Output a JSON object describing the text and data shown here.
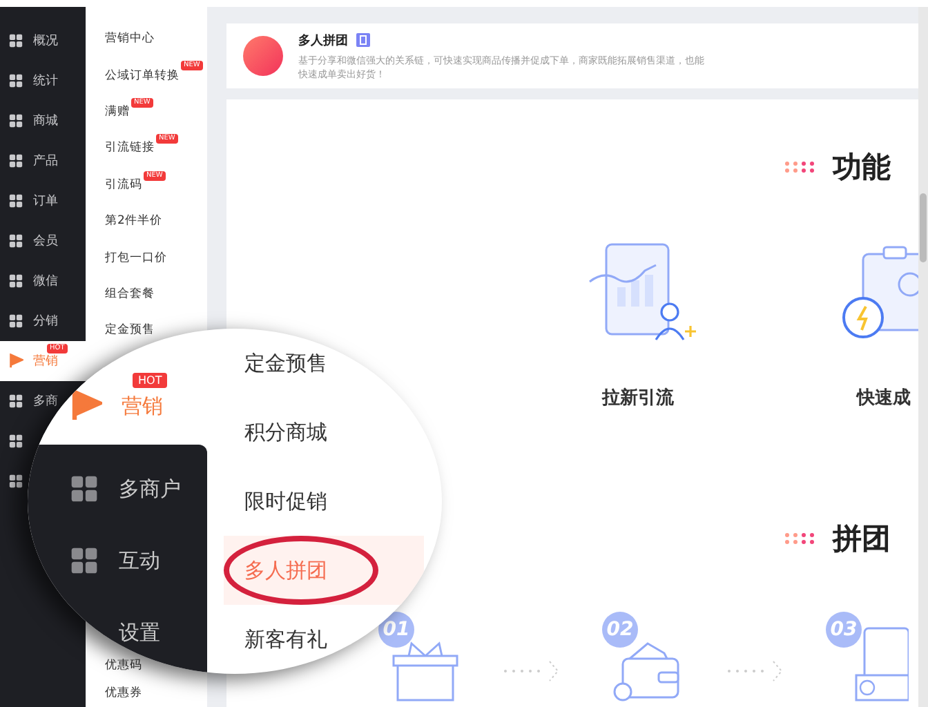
{
  "sidebar": {
    "items": [
      {
        "label": "概况",
        "selected": false
      },
      {
        "label": "统计",
        "selected": false
      },
      {
        "label": "商城",
        "selected": false
      },
      {
        "label": "产品",
        "selected": false
      },
      {
        "label": "订单",
        "selected": false
      },
      {
        "label": "会员",
        "selected": false
      },
      {
        "label": "微信",
        "selected": false
      },
      {
        "label": "分销",
        "selected": false
      },
      {
        "label": "营销",
        "selected": true,
        "badge": "HOT"
      },
      {
        "label": "多商",
        "selected": false
      },
      {
        "selected": false
      },
      {
        "selected": false
      }
    ]
  },
  "submenu": {
    "items": [
      {
        "label": "营销中心"
      },
      {
        "label": "公域订单转换",
        "badge": "NEW"
      },
      {
        "label": "满赠",
        "badge": "NEW"
      },
      {
        "label": "引流链接",
        "badge": "NEW"
      },
      {
        "label": "引流码",
        "badge": "NEW"
      },
      {
        "label": "第2件半价"
      },
      {
        "label": "打包一口价"
      },
      {
        "label": "组合套餐"
      },
      {
        "label": "定金预售"
      }
    ],
    "bottom_items": [
      {
        "label": "优惠码"
      },
      {
        "label": "优惠券"
      }
    ]
  },
  "header": {
    "title": "多人拼团",
    "description": "基于分享和微信强大的关系链，可快速实现商品传播并促成下单，商家既能拓展销售渠道，也能快速成单卖出好货！"
  },
  "sections": [
    {
      "title": "功能",
      "features": [
        {
          "label": "拉新引流"
        },
        {
          "label": "快速成"
        }
      ]
    },
    {
      "title": "拼团",
      "steps": [
        {
          "number": "01"
        },
        {
          "number": "02"
        },
        {
          "number": "03"
        }
      ]
    }
  ],
  "magnifier": {
    "nav": [
      {
        "label": "营销",
        "selected": true,
        "badge": "HOT"
      },
      {
        "label": "多商户",
        "selected": false
      },
      {
        "label": "互动",
        "selected": false
      },
      {
        "label": "设置",
        "selected": false
      }
    ],
    "items": [
      {
        "label": "定金预售",
        "selected": false
      },
      {
        "label": "积分商城",
        "selected": false
      },
      {
        "label": "限时促销",
        "selected": false
      },
      {
        "label": "多人拼团",
        "selected": true
      },
      {
        "label": "新客有礼",
        "selected": false
      }
    ]
  }
}
